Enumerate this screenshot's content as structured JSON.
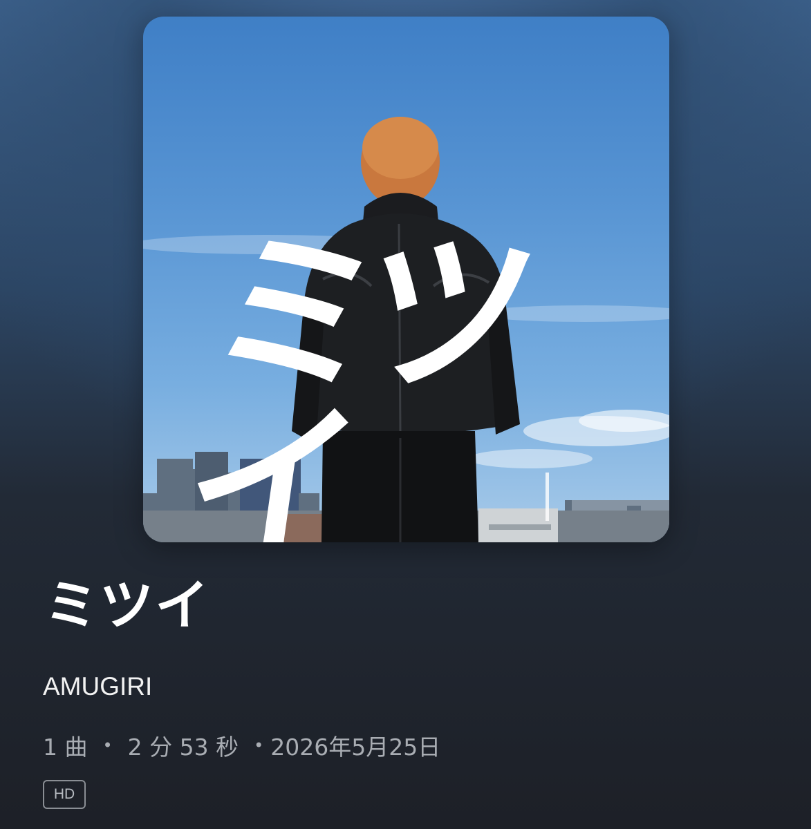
{
  "album": {
    "cover_text": "ミツイ",
    "title": "ミツイ",
    "artist": "AMUGIRI",
    "track_count": "1 曲",
    "duration": "2 分 53 秒",
    "release_date": "2026年5月25日",
    "separator": "•",
    "quality_badge": "HD"
  }
}
